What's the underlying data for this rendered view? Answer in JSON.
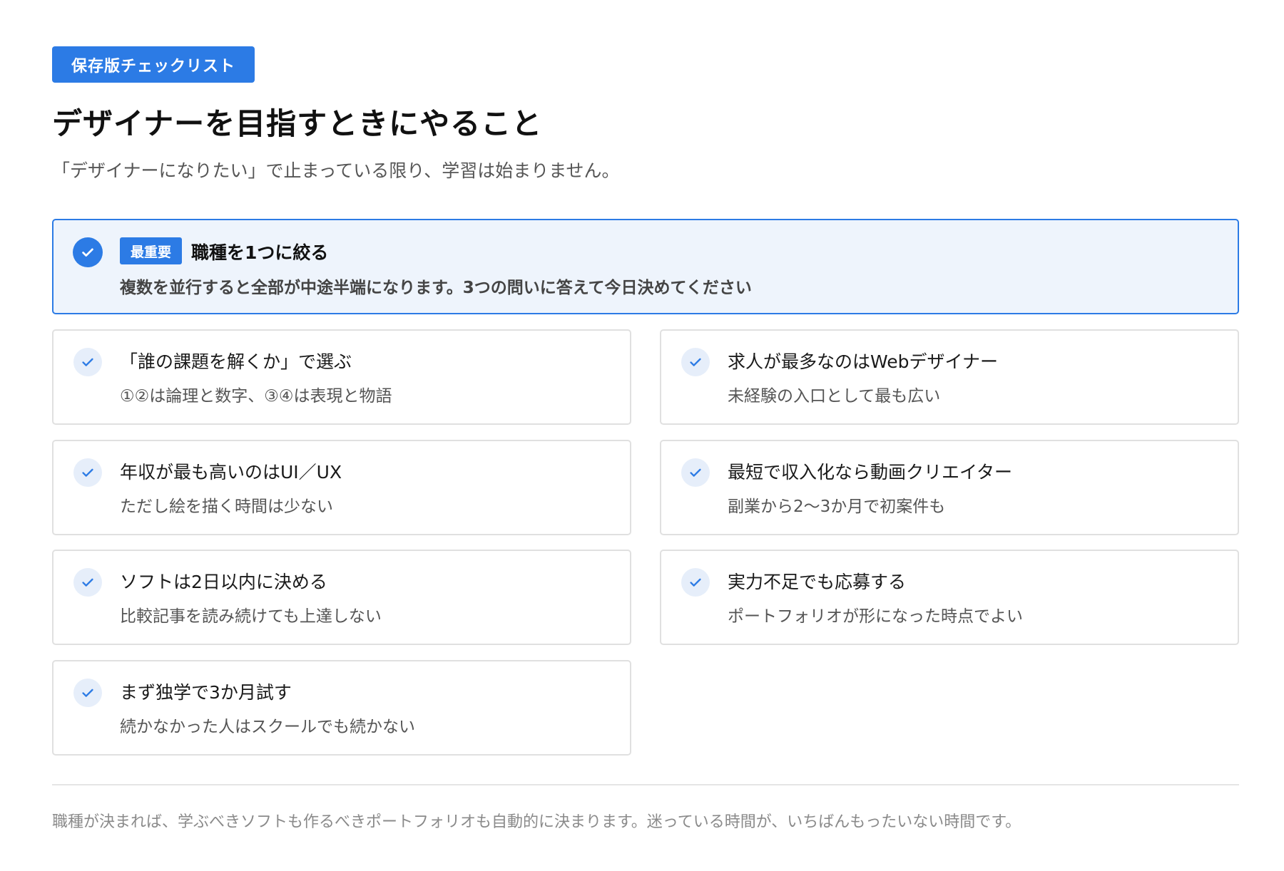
{
  "tag": "保存版チェックリスト",
  "title": "デザイナーを目指すときにやること",
  "subtitle": "「デザイナーになりたい」で止まっている限り、学習は始まりません。",
  "featured": {
    "badge": "最重要",
    "title": "職種を1つに絞る",
    "description": "複数を並行すると全部が中途半端になります。3つの問いに答えて今日決めてください"
  },
  "items": [
    {
      "title": "「誰の課題を解くか」で選ぶ",
      "description": "①②は論理と数字、③④は表現と物語"
    },
    {
      "title": "求人が最多なのはWebデザイナー",
      "description": "未経験の入口として最も広い"
    },
    {
      "title": "年収が最も高いのはUI／UX",
      "description": "ただし絵を描く時間は少ない"
    },
    {
      "title": "最短で収入化なら動画クリエイター",
      "description": "副業から2〜3か月で初案件も"
    },
    {
      "title": "ソフトは2日以内に決める",
      "description": "比較記事を読み続けても上達しない"
    },
    {
      "title": "実力不足でも応募する",
      "description": "ポートフォリオが形になった時点でよい"
    },
    {
      "title": "まず独学で3か月試す",
      "description": "続かなかった人はスクールでも続かない"
    }
  ],
  "footer": "職種が決まれば、学ぶべきソフトも作るべきポートフォリオも自動的に決まります。迷っている時間が、いちばんもったいない時間です。",
  "colors": {
    "accent": "#2c7be5",
    "featured_bg": "#eef4fc",
    "check_bg": "#e6eefa"
  }
}
